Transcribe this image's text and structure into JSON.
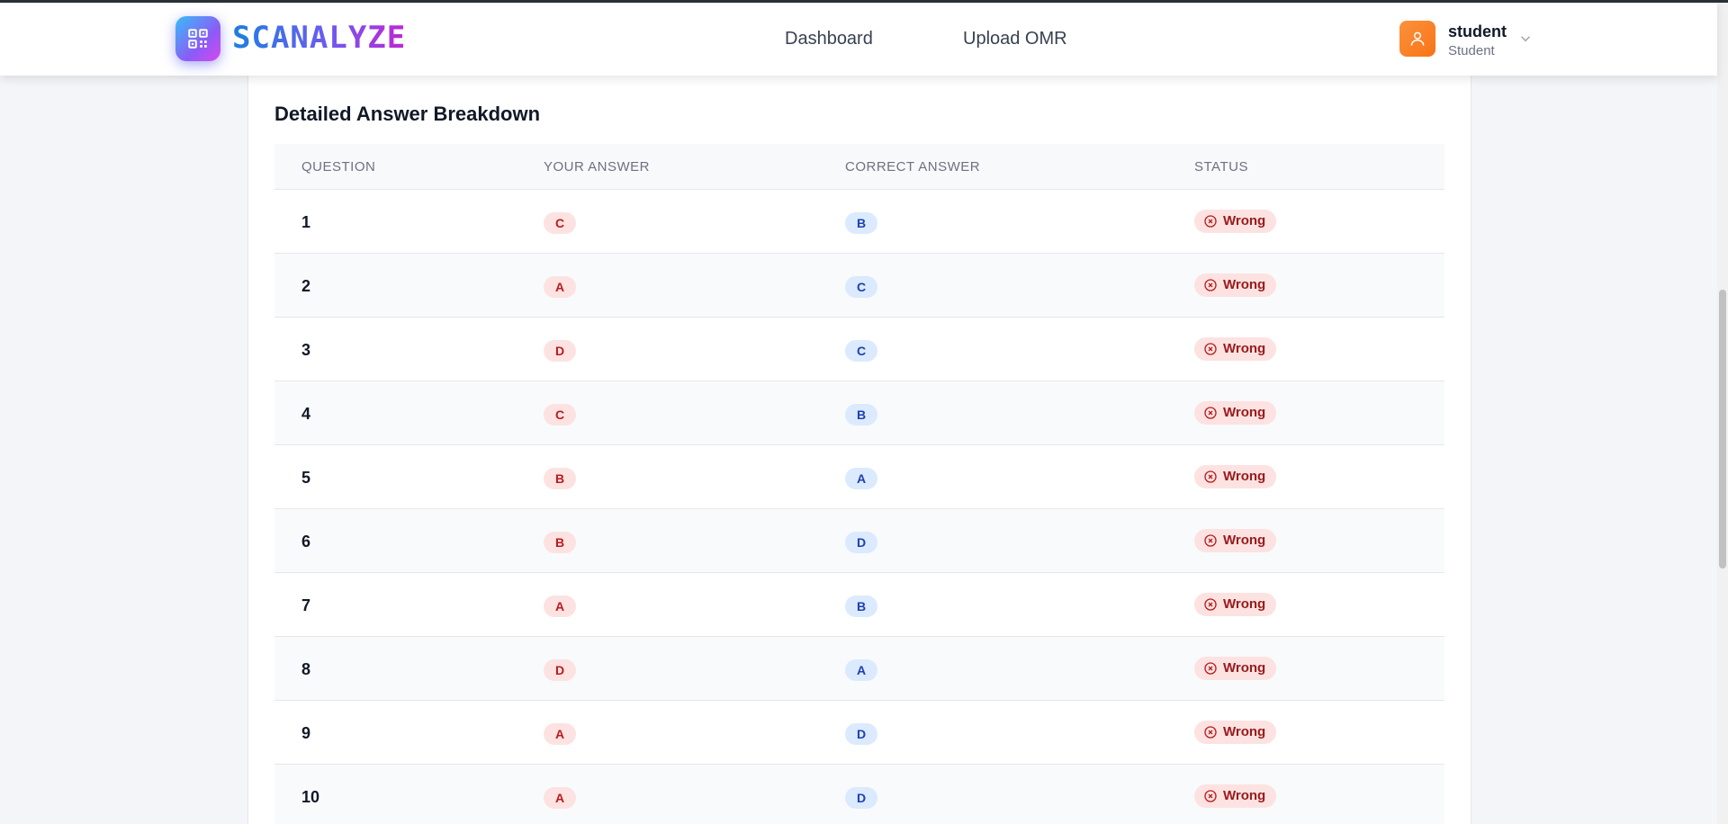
{
  "brand": {
    "name": "SCANALYZE"
  },
  "nav": {
    "dashboard": "Dashboard",
    "upload": "Upload OMR"
  },
  "user": {
    "name": "student",
    "role": "Student"
  },
  "section": {
    "title": "Detailed Answer Breakdown"
  },
  "table": {
    "headers": {
      "question": "QUESTION",
      "your": "YOUR ANSWER",
      "correct": "CORRECT ANSWER",
      "status": "STATUS"
    },
    "rows": [
      {
        "q": "1",
        "your": "C",
        "correct": "B",
        "status": "Wrong"
      },
      {
        "q": "2",
        "your": "A",
        "correct": "C",
        "status": "Wrong"
      },
      {
        "q": "3",
        "your": "D",
        "correct": "C",
        "status": "Wrong"
      },
      {
        "q": "4",
        "your": "C",
        "correct": "B",
        "status": "Wrong"
      },
      {
        "q": "5",
        "your": "B",
        "correct": "A",
        "status": "Wrong"
      },
      {
        "q": "6",
        "your": "B",
        "correct": "D",
        "status": "Wrong"
      },
      {
        "q": "7",
        "your": "A",
        "correct": "B",
        "status": "Wrong"
      },
      {
        "q": "8",
        "your": "D",
        "correct": "A",
        "status": "Wrong"
      },
      {
        "q": "9",
        "your": "A",
        "correct": "D",
        "status": "Wrong"
      },
      {
        "q": "10",
        "your": "A",
        "correct": "D",
        "status": "Wrong"
      }
    ]
  },
  "icons": {
    "logo": "qr-code-icon",
    "avatar": "user-icon",
    "chevron": "chevron-down-icon",
    "status": "x-circle-icon"
  },
  "colors": {
    "accent_gradient": [
      "#38bdf8",
      "#8b5cf6",
      "#d946ef"
    ],
    "avatar": "#f97316",
    "wrong_bg": "#fde2e2",
    "wrong_text": "#991b1b",
    "correct_bg": "#dbeafe",
    "correct_text": "#1e40af"
  }
}
